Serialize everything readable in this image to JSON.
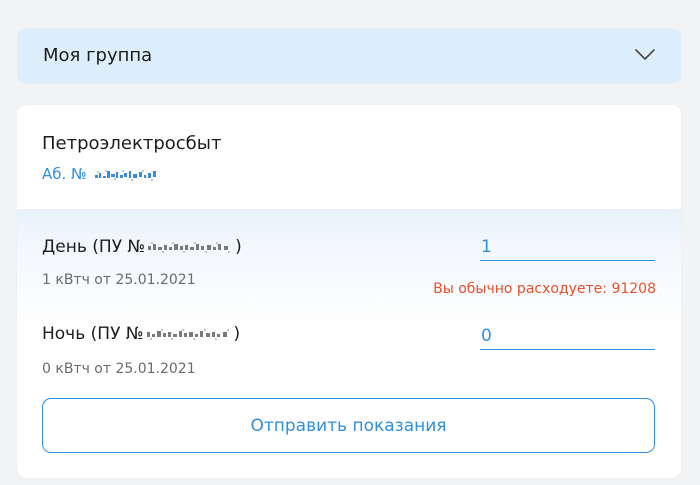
{
  "group": {
    "label": "Моя группа"
  },
  "card": {
    "provider": "Петроэлектросбыт",
    "account_prefix": "Аб. №"
  },
  "meters": [
    {
      "name_prefix": "День (ПУ №",
      "name_suffix": ")",
      "subtitle": "1 кВтч от 25.01.2021",
      "reading": "1",
      "warning": "Вы обычно расходуете: 91208"
    },
    {
      "name_prefix": "Ночь (ПУ №",
      "name_suffix": ")",
      "subtitle": "0 кВтч от 25.01.2021",
      "reading": "0"
    }
  ],
  "submit_label": "Отправить показания",
  "colors": {
    "accent": "#2f8fe0",
    "warning": "#e8502b",
    "group_bg": "#dcedfb"
  },
  "icons": {
    "group_toggle": "chevron-down-icon"
  }
}
